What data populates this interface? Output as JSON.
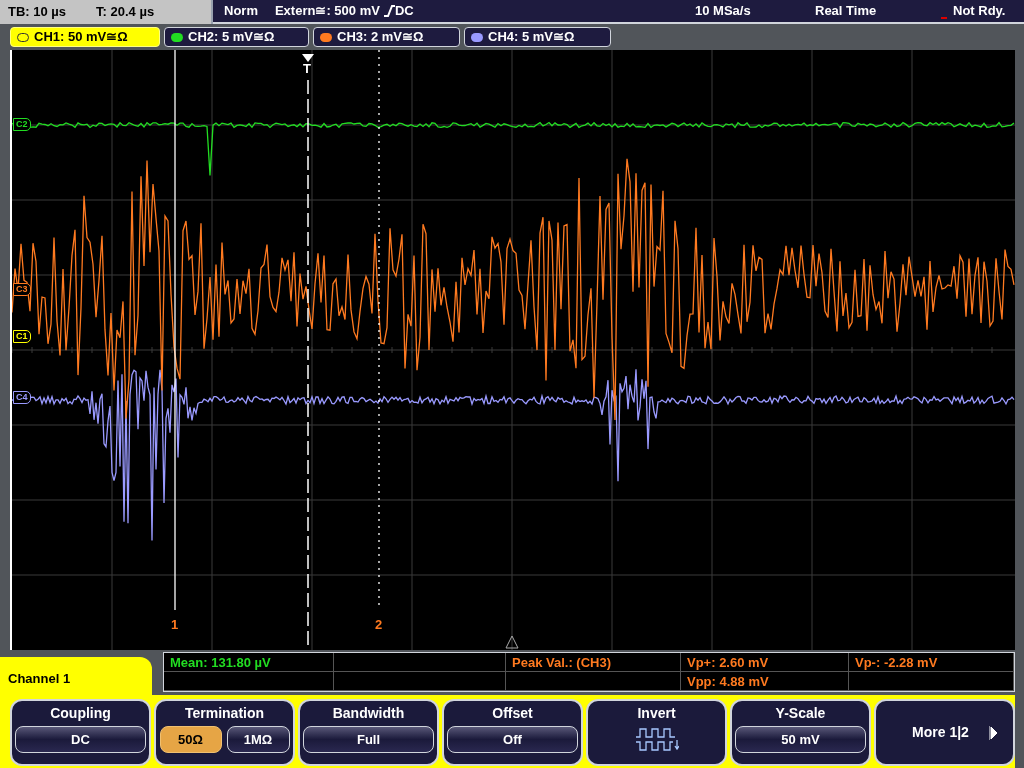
{
  "status_bar": {
    "timebase": "TB: 10 µs",
    "trigger_time": "T: 20.4 µs",
    "trigger_mode": "Norm",
    "trigger_source": "Extern≅: 500 mV",
    "trigger_coupling": "DC",
    "sample_rate": "10 MSa/s",
    "acquisition": "Real Time",
    "status": "Not Rdy."
  },
  "channel_tabs": [
    {
      "label": "CH1: 50 mV≅Ω",
      "color": "#ffff00",
      "selected": true
    },
    {
      "label": "CH2: 5 mV≅Ω",
      "color": "#22dd22",
      "selected": false
    },
    {
      "label": "CH3: 2 mV≅Ω",
      "color": "#ff7a20",
      "selected": false
    },
    {
      "label": "CH4: 5 mV≅Ω",
      "color": "#9a9aff",
      "selected": false
    }
  ],
  "channel_markers": [
    {
      "label": "C2",
      "color": "#22dd22"
    },
    {
      "label": "C3",
      "color": "#ff7a20"
    },
    {
      "label": "C1",
      "color": "#ffff00"
    },
    {
      "label": "C4",
      "color": "#9a9aff"
    }
  ],
  "trigger_marker": "T",
  "cursors": [
    {
      "label": "1"
    },
    {
      "label": "2"
    }
  ],
  "measurements": [
    {
      "text": "Mean: 131.80 µV",
      "kind": "mean"
    },
    {
      "text": "Peak Val.:  (CH3)",
      "kind": "peak"
    },
    {
      "text": "Vp+: 2.60 mV",
      "kind": "peak"
    },
    {
      "text": "Vp-: -2.28 mV",
      "kind": "peak"
    },
    {
      "text": "Vpp: 4.88 mV",
      "kind": "peak"
    }
  ],
  "menu": {
    "title": "Channel 1",
    "softkeys": [
      {
        "kind": "value",
        "label": "Coupling",
        "value": "DC"
      },
      {
        "kind": "choice",
        "label": "Termination",
        "options": [
          {
            "text": "50Ω",
            "selected": true
          },
          {
            "text": "1MΩ",
            "selected": false
          }
        ]
      },
      {
        "kind": "value",
        "label": "Bandwidth",
        "value": "Full"
      },
      {
        "kind": "value",
        "label": "Offset",
        "value": "Off"
      },
      {
        "kind": "icon",
        "label": "Invert"
      },
      {
        "kind": "value",
        "label": "Y-Scale",
        "value": "50 mV"
      },
      {
        "kind": "more",
        "label": "More 1|2"
      }
    ]
  }
}
